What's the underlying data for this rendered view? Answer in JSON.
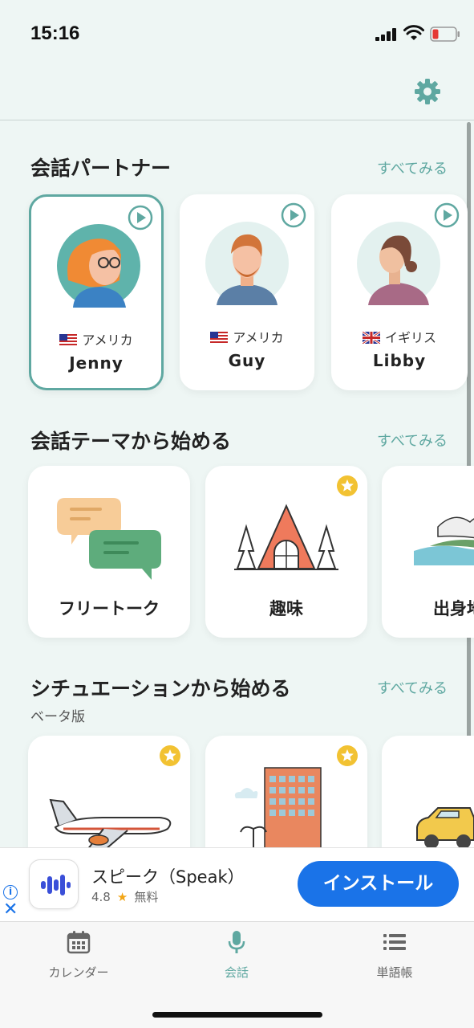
{
  "status_bar": {
    "time": "15:16"
  },
  "sections": {
    "partners": {
      "title": "会話パートナー",
      "see_all": "すべてみる"
    },
    "themes": {
      "title": "会話テーマから始める",
      "see_all": "すべてみる"
    },
    "situations": {
      "title": "シチュエーションから始める",
      "subtitle": "ベータ版",
      "see_all": "すべてみる"
    }
  },
  "partners": [
    {
      "name": "Jenny",
      "country": "アメリカ",
      "flag": "us-flag-icon",
      "selected": true
    },
    {
      "name": "Guy",
      "country": "アメリカ",
      "flag": "us-flag-icon",
      "selected": false
    },
    {
      "name": "Libby",
      "country": "イギリス",
      "flag": "uk-flag-icon",
      "selected": false
    }
  ],
  "themes": [
    {
      "label": "フリートーク",
      "icon": "chat-bubbles-icon",
      "starred": false
    },
    {
      "label": "趣味",
      "icon": "cabin-icon",
      "starred": true
    },
    {
      "label": "出身地",
      "icon": "island-icon",
      "starred": false
    }
  ],
  "situations": [
    {
      "icon": "airplane-icon",
      "starred": true
    },
    {
      "icon": "hotel-icon",
      "starred": true
    },
    {
      "icon": "taxi-icon",
      "starred": false
    }
  ],
  "ad": {
    "app_name": "スピーク（Speak）",
    "rating": "4.8",
    "price": "無料",
    "install_label": "インストール"
  },
  "tabbar": {
    "tabs": [
      {
        "label": "カレンダー",
        "icon": "calendar-icon",
        "active": false
      },
      {
        "label": "会話",
        "icon": "microphone-icon",
        "active": true
      },
      {
        "label": "単語帳",
        "icon": "list-icon",
        "active": false
      }
    ]
  },
  "colors": {
    "accent": "#5fa8a1",
    "background": "#eef6f4",
    "install": "#1a73e8",
    "star": "#f2c232"
  }
}
